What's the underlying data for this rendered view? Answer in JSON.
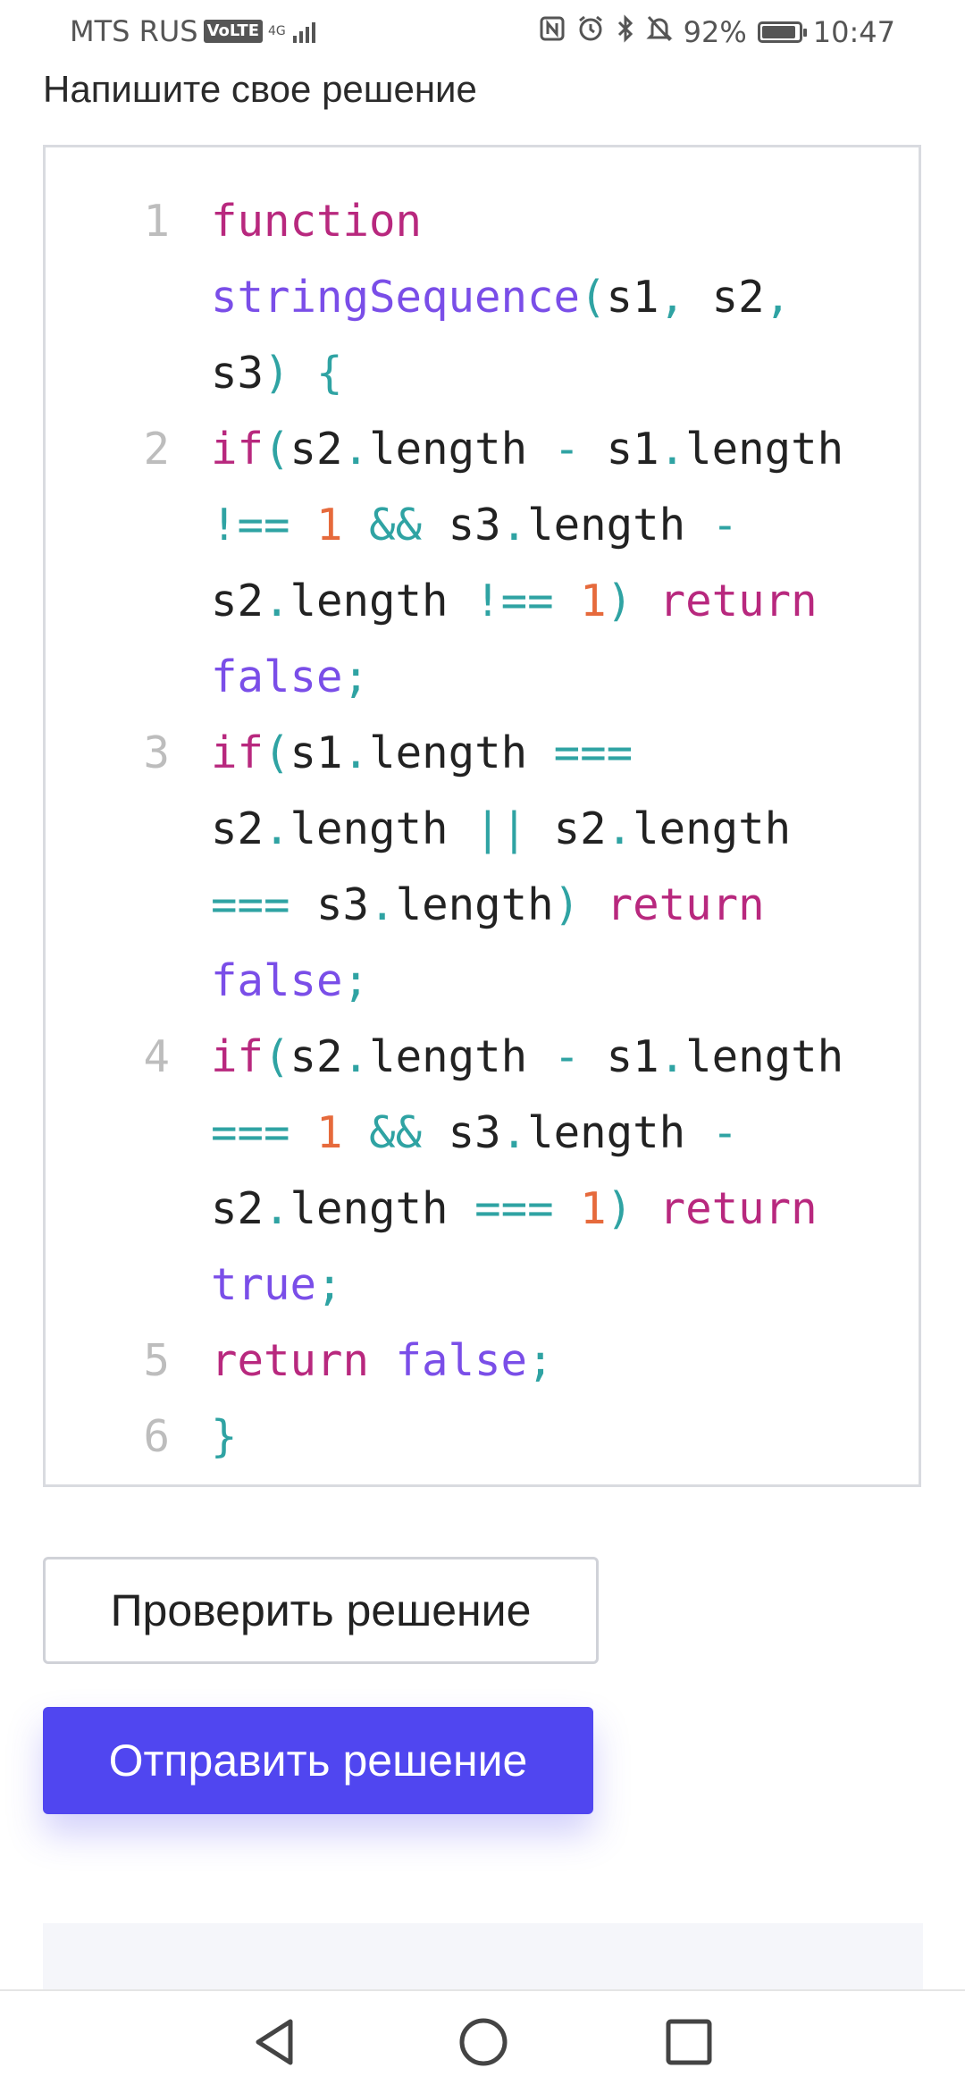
{
  "status_bar": {
    "carrier": "MTS RUS",
    "volte": "VoLTE",
    "network": "4G",
    "battery_percent": "92%",
    "battery_level": 0.92,
    "time": "10:47"
  },
  "heading": "Напишите свое решение",
  "editor": {
    "line_numbers": [
      "1",
      "2",
      "3",
      "4",
      "5",
      "6"
    ],
    "lines": [
      "function stringSequence(s1, s2, s3) {",
      "if(s2.length - s1.length !== 1 && s3.length - s2.length !== 1) return false;",
      "if(s1.length === s2.length || s2.length === s3.length) return false;",
      "if(s2.length - s1.length === 1 && s3.length - s2.length === 1) return true;",
      "return false;",
      "}"
    ],
    "colors": {
      "keyword": "#b8287e",
      "function_name": "#7a4ee8",
      "punctuation": "#2fa3a3",
      "number": "#e66a3c",
      "line_number": "#bdbdbd"
    }
  },
  "buttons": {
    "check": "Проверить решение",
    "submit": "Отправить решение",
    "submit_color": "#5046f0"
  },
  "nav": {
    "back_icon": "back-triangle-icon",
    "home_icon": "home-circle-icon",
    "recent_icon": "recent-square-icon"
  }
}
